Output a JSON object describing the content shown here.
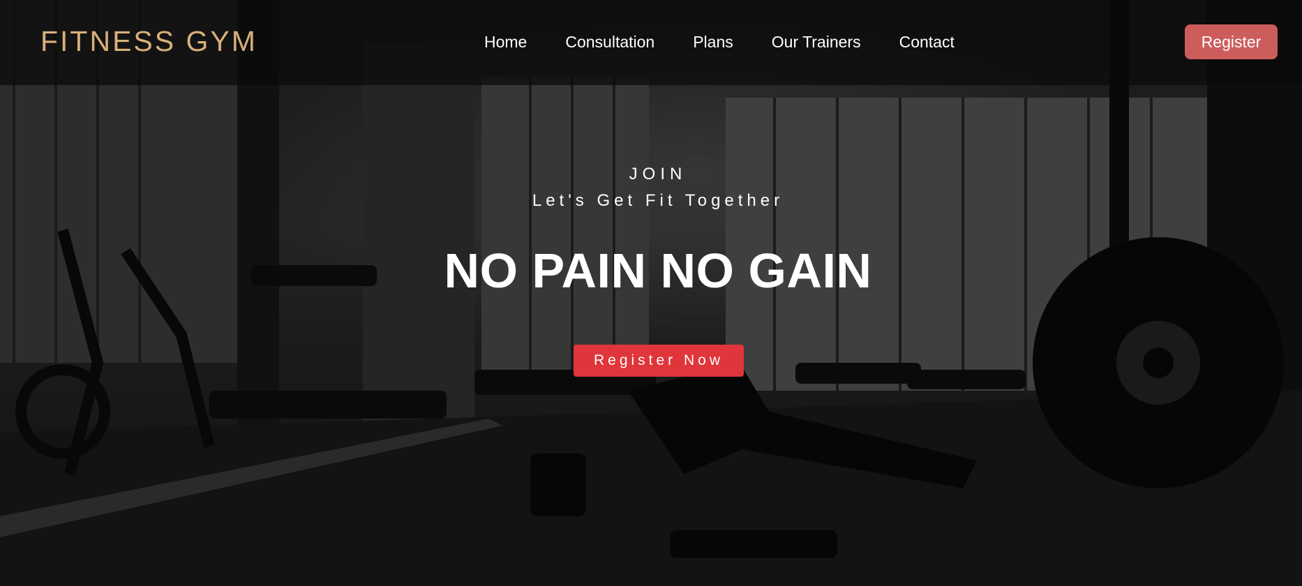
{
  "colors": {
    "brand": "#d9b07a",
    "register_button": "#cd5c5c",
    "cta_button": "#e0353a",
    "text": "#ffffff"
  },
  "header": {
    "brand": "FITNESS GYM",
    "nav": [
      "Home",
      "Consultation",
      "Plans",
      "Our Trainers",
      "Contact"
    ],
    "register_label": "Register"
  },
  "hero": {
    "kicker": "JOIN",
    "tagline": "Let's Get Fit Together",
    "headline": "NO PAIN NO GAIN",
    "cta_label": "Register Now",
    "background_image": "gym-interior-photo"
  }
}
